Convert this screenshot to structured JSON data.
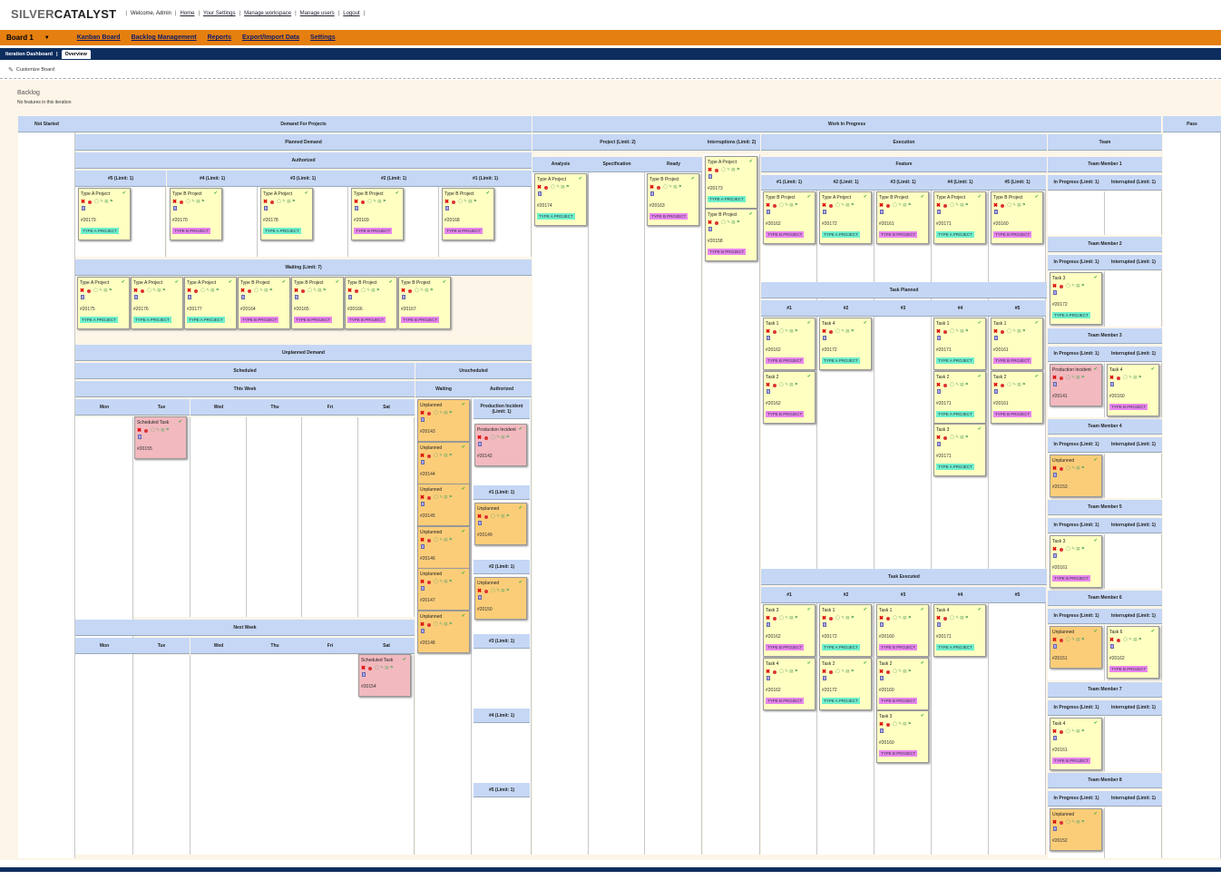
{
  "app": {
    "logo_light": "SILVER",
    "logo_bold": "CATALYST",
    "welcome": "Welcome, Admin"
  },
  "topnav": [
    "Home",
    "Your Settings",
    "Manage workspace",
    "Manage users",
    "Logout"
  ],
  "menu": {
    "board": "Board 1",
    "items": [
      "Kanban Board",
      "Backlog Management",
      "Reports",
      "Export/Import Data",
      "Settings"
    ]
  },
  "tabs": [
    "Iteration Dashboard",
    "Overview"
  ],
  "customize": "Customize Board",
  "backlog": {
    "title": "Backlog",
    "subtitle": "No features in this iteration"
  },
  "headers": {
    "not_started": "Not Started",
    "demand": "Demand For Projects",
    "wip": "Work In Progress",
    "pass": "Pass",
    "planned": "Planned Demand",
    "authorized": "Authorized",
    "waiting": "Waiting (Limit: 7)",
    "unplanned": "Unplanned Demand",
    "scheduled": "Scheduled",
    "unscheduled": "Unscheduled",
    "this_week": "This Week",
    "next_week": "Next Week",
    "un_waiting": "Waiting",
    "un_authorized": "Authorized",
    "prod_incident": "Production Incident (Limit: 1)",
    "project": "Project (Limit: 2)",
    "interruptions": "Interruptions (Limit: 2)",
    "execution": "Execution",
    "team": "Team",
    "analysis": "Analysis",
    "specification": "Specification",
    "ready": "Ready",
    "feature": "Feature",
    "task_planned": "Task Planned",
    "task_executed": "Task Executed"
  },
  "auth_cols": [
    "#5 (Limit: 1)",
    "#4 (Limit: 1)",
    "#3 (Limit: 1)",
    "#2 (Limit: 1)",
    "#1 (Limit: 1)"
  ],
  "days": [
    "Mon",
    "Tue",
    "Wed",
    "Thu",
    "Fri",
    "Sat"
  ],
  "unauth_slots": [
    "#1 (Limit: 1)",
    "#2 (Limit: 1)",
    "#3 (Limit: 1)",
    "#4 (Limit: 1)",
    "#5 (Limit: 1)"
  ],
  "feature_cols": [
    "#1 (Limit: 1)",
    "#2 (Limit: 1)",
    "#3 (Limit: 1)",
    "#4 (Limit: 1)",
    "#5 (Limit: 1)"
  ],
  "task_cols": [
    "#1",
    "#2",
    "#3",
    "#4",
    "#5"
  ],
  "team_members": [
    "Team Member 1",
    "Team Member 2",
    "Team Member 3",
    "Team Member 4",
    "Team Member 5",
    "Team Member 6",
    "Team Member 7",
    "Team Member 8"
  ],
  "team_sub": [
    "In Progress (Limit: 1)",
    "Interrupted (Limit: 1)"
  ],
  "labels": {
    "a": "TYPE A PROJECT",
    "b": "TYPE B PROJECT"
  },
  "cards": {
    "auth": [
      [
        "Type A Project",
        "#20179",
        "a"
      ],
      [
        "Type B Project",
        "#20170",
        "b"
      ],
      [
        "Type A Project",
        "#20178",
        "a"
      ],
      [
        "Type B Project",
        "#20169",
        "b"
      ],
      [
        "Type B Project",
        "#20168",
        "b"
      ]
    ],
    "waiting": [
      [
        "Type A Project",
        "#20175",
        "a"
      ],
      [
        "Type A Project",
        "#20176",
        "a"
      ],
      [
        "Type A Project",
        "#20177",
        "a"
      ],
      [
        "Type B Project",
        "#20164",
        "b"
      ],
      [
        "Type B Project",
        "#20165",
        "b"
      ],
      [
        "Type B Project",
        "#20166",
        "b"
      ],
      [
        "Type B Project",
        "#20167",
        "b"
      ]
    ],
    "sched1": [
      "Scheduled Task",
      "#20155"
    ],
    "sched2": [
      "Scheduled Task",
      "#20154"
    ],
    "unwait": [
      "#20143",
      "#20144",
      "#20145",
      "#20146",
      "#20147",
      "#20148"
    ],
    "unplanned": "Unplanned",
    "prod": [
      "Production Incident",
      "#20142"
    ],
    "slot1": "#20149",
    "slot2": "#20150",
    "analysis": [
      "Type A Project",
      "#20174",
      "a"
    ],
    "ready": [
      "Type B Project",
      "#20163",
      "b"
    ],
    "interrupt": [
      [
        "Type A Project",
        "#20173",
        "a"
      ],
      [
        "Type B Project",
        "#20158",
        "b"
      ]
    ],
    "feature": [
      [
        "Type B Project",
        "#20162",
        "b"
      ],
      [
        "Type A Project",
        "#20172",
        "a"
      ],
      [
        "Type B Project",
        "#20161",
        "b"
      ],
      [
        "Type A Project",
        "#20171",
        "a"
      ],
      [
        "Type B Project",
        "#20160",
        "b"
      ]
    ],
    "tplanned": [
      [
        0,
        [
          "Task 1",
          "#20162",
          "b"
        ]
      ],
      [
        0,
        [
          "Task 2",
          "#20162",
          "b"
        ]
      ],
      [
        1,
        [
          "Task 4",
          "#20172",
          "a"
        ]
      ],
      [
        3,
        [
          "Task 1",
          "#20171",
          "a"
        ]
      ],
      [
        3,
        [
          "Task 2",
          "#20171",
          "a"
        ]
      ],
      [
        3,
        [
          "Task 3",
          "#20171",
          "a"
        ]
      ],
      [
        4,
        [
          "Task 1",
          "#20161",
          "b"
        ]
      ],
      [
        4,
        [
          "Task 2",
          "#20161",
          "b"
        ]
      ]
    ],
    "texec": [
      [
        0,
        [
          "Task 3",
          "#20162",
          "b"
        ]
      ],
      [
        0,
        [
          "Task 4",
          "#20162",
          "b"
        ]
      ],
      [
        1,
        [
          "Task 1",
          "#20172",
          "a"
        ]
      ],
      [
        1,
        [
          "Task 2",
          "#20172",
          "a"
        ]
      ],
      [
        2,
        [
          "Task 1",
          "#20160",
          "b"
        ]
      ],
      [
        2,
        [
          "Task 2",
          "#20160",
          "b"
        ]
      ],
      [
        2,
        [
          "Task 3",
          "#20160",
          "b"
        ]
      ],
      [
        3,
        [
          "Task 4",
          "#20171",
          "a"
        ]
      ]
    ],
    "team": [
      [
        1,
        0,
        [
          "Task 3",
          "#20172",
          "a"
        ]
      ],
      [
        2,
        0,
        [
          "Production Incident",
          "#20141",
          ""
        ]
      ],
      [
        2,
        1,
        [
          "Task 4",
          "#20160",
          "b"
        ]
      ],
      [
        3,
        0,
        [
          "Unplanned",
          "#20153",
          ""
        ]
      ],
      [
        4,
        0,
        [
          "Task 3",
          "#20161",
          "b"
        ]
      ],
      [
        5,
        0,
        [
          "Unplanned",
          "#20151",
          ""
        ]
      ],
      [
        5,
        1,
        [
          "Task 6",
          "#20162",
          "b"
        ]
      ],
      [
        6,
        0,
        [
          "Task 4",
          "#20161",
          "b"
        ]
      ],
      [
        7,
        0,
        [
          "Unplanned",
          "#20152",
          ""
        ]
      ]
    ]
  }
}
